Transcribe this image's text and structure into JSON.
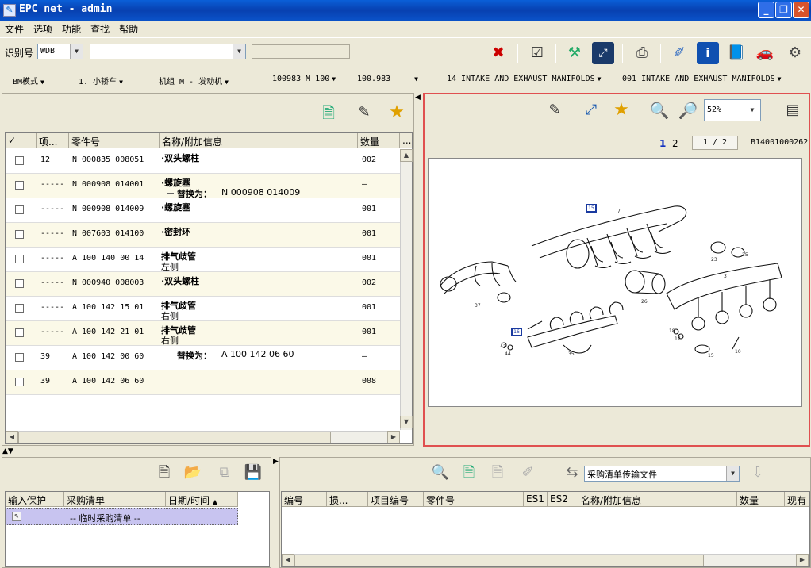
{
  "window": {
    "title": "EPC net - admin",
    "app_icon": "feather-icon",
    "buttons": [
      "minimize-icon",
      "restore-icon",
      "close-icon"
    ]
  },
  "menu": [
    "文件",
    "选项",
    "功能",
    "查找",
    "帮助"
  ],
  "toolbar": {
    "vin_label": "识别号",
    "vin_prefix": "WDB",
    "vin_value": "",
    "icons": [
      "delete-icon",
      "checklist-icon",
      "service-icon",
      "fit-icon",
      "print-icon",
      "eraser-icon",
      "info-icon",
      "manual-icon",
      "car-icon",
      "settings-icon"
    ]
  },
  "breadcrumb": [
    {
      "label": "BM模式"
    },
    {
      "label": "1. 小轿车"
    },
    {
      "label": "机组 M  - 发动机"
    },
    {
      "label": "100983 M 100"
    },
    {
      "label": "100.983"
    },
    {
      "label": "14 INTAKE AND EXHAUST MANIFOLDS"
    },
    {
      "label": "001 INTAKE AND EXHAUST MANIFOLDS"
    }
  ],
  "parts_panel": {
    "columns": [
      "✓",
      "项...",
      "零件号",
      "名称/附加信息",
      "数量",
      "..."
    ],
    "rows": [
      {
        "item": "12",
        "part": "N 000835 008051",
        "name": "·双头螺柱",
        "sub": "",
        "qty": "002",
        "cream": false
      },
      {
        "item": "-----",
        "part": "N 000908 014001",
        "name": "·螺旋塞",
        "sub_label": "替换为：",
        "sub": "N 000908 014009",
        "qty": "–",
        "cream": true
      },
      {
        "item": "-----",
        "part": "N 000908 014009",
        "name": "·螺旋塞",
        "sub": "",
        "qty": "001",
        "cream": false
      },
      {
        "item": "-----",
        "part": "N 007603 014100",
        "name": "·密封环",
        "sub": "",
        "qty": "001",
        "cream": true
      },
      {
        "item": "-----",
        "part": "A 100 140 00 14",
        "name": "排气歧管",
        "line2": "左侧",
        "qty": "001",
        "cream": false
      },
      {
        "item": "-----",
        "part": "N 000940 008003",
        "name": "·双头螺柱",
        "sub": "",
        "qty": "002",
        "cream": true
      },
      {
        "item": "-----",
        "part": "A 100 142 15 01",
        "name": "排气歧管",
        "line2": "右侧",
        "qty": "001",
        "cream": false
      },
      {
        "item": "-----",
        "part": "A 100 142 21 01",
        "name": "排气歧管",
        "line2": "右侧",
        "qty": "001",
        "cream": true
      },
      {
        "item": "39",
        "part": "A 100 142 00 60",
        "name": "",
        "sub_label": "替换为：",
        "sub": "A 100 142 06 60",
        "qty": "–",
        "cream": false
      },
      {
        "item": "39",
        "part": "A 100 142 06 60",
        "name": "",
        "sub": "",
        "qty": "008",
        "cream": true
      }
    ]
  },
  "image_panel": {
    "zoom": "52%",
    "pages": [
      "1",
      "2"
    ],
    "page_indicator": "1 / 2",
    "image_code": "B14001000262",
    "callouts": [
      "15",
      "7",
      "37",
      "16",
      "23",
      "25",
      "3",
      "26",
      "35",
      "18",
      "17",
      "43",
      "44",
      "15",
      "10"
    ]
  },
  "basket_panel": {
    "columns": [
      "输入保护",
      "采购清单",
      "日期/时间"
    ],
    "row": {
      "name": "-- 临时采购清单 --"
    }
  },
  "transfer_panel": {
    "select_value": "采购清单传输文件",
    "columns": [
      "编号",
      "损...",
      "项目编号",
      "零件号",
      "ES1",
      "ES2",
      "名称/附加信息",
      "数量",
      "现有"
    ]
  }
}
